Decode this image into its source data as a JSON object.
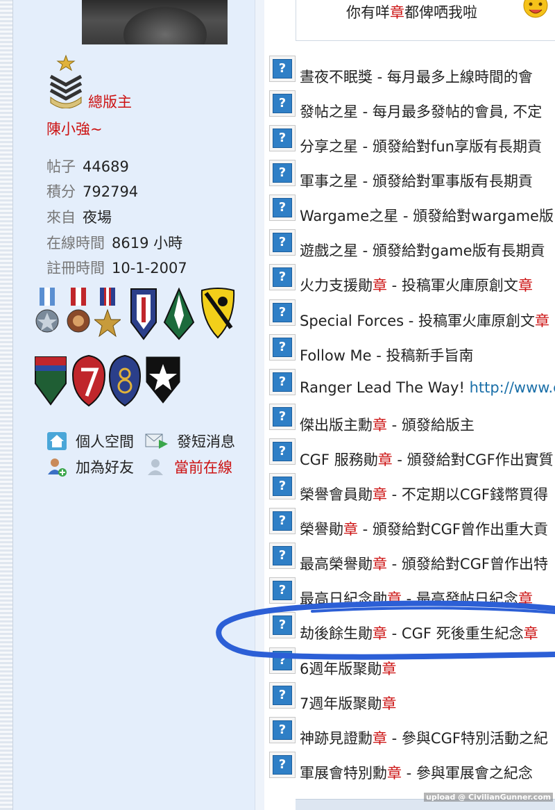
{
  "top_banner": {
    "prefix": "你有咩",
    "highlight": "章",
    "suffix": "都俾哂我啦"
  },
  "profile": {
    "group": "總版主",
    "username": "陳小強~",
    "stats": [
      {
        "label": "帖子",
        "value": "44689"
      },
      {
        "label": "積分",
        "value": "792794"
      },
      {
        "label": "來自",
        "value": "夜場"
      },
      {
        "label": "在線時間",
        "value": "8619 小時"
      },
      {
        "label": "註冊時間",
        "value": "10-1-2007"
      }
    ],
    "actions": {
      "space": "個人空間",
      "message": "發短消息",
      "add_friend": "加為好友",
      "online": "當前在線"
    }
  },
  "medals": [
    {
      "name": "晝夜不眠獎",
      "mark": "",
      "rest": "",
      "desc": " - 每月最多上線時間的會"
    },
    {
      "name": "發帖之星",
      "mark": "",
      "rest": "",
      "desc": " - 每月最多發帖的會員, 不定"
    },
    {
      "name": "分享之星",
      "mark": "",
      "rest": "",
      "desc": " - 頒發給對fun享版有長期貢"
    },
    {
      "name": "軍事之星",
      "mark": "",
      "rest": "",
      "desc": " - 頒發給對軍事版有長期貢"
    },
    {
      "name": "Wargame之星",
      "mark": "",
      "rest": "",
      "desc": " - 頒發給對wargame版"
    },
    {
      "name": "遊戲之星",
      "mark": "",
      "rest": "",
      "desc": " - 頒發給對game版有長期貢"
    },
    {
      "name": "火力支援勛",
      "mark": "章",
      "rest": "",
      "desc": " - 投稿軍火庫原創文",
      "desc_mark": "章"
    },
    {
      "name": "Special Forces",
      "mark": "",
      "rest": "",
      "desc": " - 投稿軍火庫原創文",
      "desc_mark": "章"
    },
    {
      "name": "Follow Me",
      "mark": "",
      "rest": "",
      "desc": " - 投稿新手旨南"
    },
    {
      "name": "Ranger Lead The Way!",
      "mark": "",
      "rest": "",
      "desc": " ",
      "link": "http://www.c"
    },
    {
      "name": "傑出版主勳",
      "mark": "章",
      "rest": "",
      "desc": " - 頒發給版主"
    },
    {
      "name": "CGF 服務勛",
      "mark": "章",
      "rest": "",
      "desc": " - 頒發給對CGF作出實質"
    },
    {
      "name": "榮譽會員勛",
      "mark": "章",
      "rest": "",
      "desc": " - 不定期以CGF錢幣買得"
    },
    {
      "name": "榮譽勛",
      "mark": "章",
      "rest": "",
      "desc": " - 頒發給對CGF曾作出重大貢"
    },
    {
      "name": "最高榮譽勛",
      "mark": "章",
      "rest": "",
      "desc": " - 頒發給對CGF曾作出特"
    },
    {
      "name": "最高日紀念勛",
      "mark": "章",
      "rest": "",
      "desc": " - 最高發帖日紀念",
      "desc_mark": "章"
    },
    {
      "name": "劫後餘生勛",
      "mark": "章",
      "rest": "",
      "desc": " - CGF 死後重生紀念",
      "desc_mark": "章"
    },
    {
      "name": "6週年版聚勛",
      "mark": "章",
      "rest": "",
      "desc": ""
    },
    {
      "name": "7週年版聚勛",
      "mark": "章",
      "rest": "",
      "desc": ""
    },
    {
      "name": "神跡見證勳",
      "mark": "章",
      "rest": "",
      "desc": " - 參與CGF特別活動之紀"
    },
    {
      "name": "軍展會特別勳",
      "mark": "章",
      "rest": "",
      "desc": " - 參與軍展會之紀念"
    }
  ],
  "medal_icon_glyph": "?",
  "watermark": "upload @ CivilianGunner.com",
  "colors": {
    "accent_red": "#cc1111",
    "sidebar_bg": "#e4eefb",
    "link_blue": "#1a6fa8",
    "scribble": "#2c5fd6"
  }
}
